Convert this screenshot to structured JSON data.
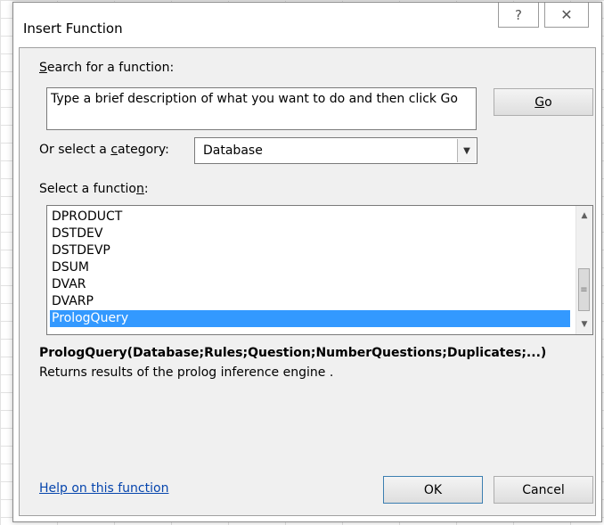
{
  "dialog": {
    "title": "Insert Function",
    "help_icon": "question-mark-icon",
    "close_icon": "close-icon",
    "help_glyph": "?",
    "close_glyph": "✕"
  },
  "search": {
    "label_pre": "",
    "label_ul": "S",
    "label_post": "earch for a function:",
    "value": "Type a brief description of what you want to do and then click Go",
    "go_pre": "",
    "go_ul": "G",
    "go_post": "o"
  },
  "category": {
    "label_pre": "Or select a ",
    "label_ul": "c",
    "label_post": "ategory:",
    "value": "Database",
    "arrow_glyph": "▼"
  },
  "functions": {
    "label_pre": "Select a functio",
    "label_ul": "n",
    "label_post": ":",
    "items": [
      "DPRODUCT",
      "DSTDEV",
      "DSTDEVP",
      "DSUM",
      "DVAR",
      "DVARP",
      "PrologQuery"
    ],
    "selected_index": 6,
    "scroll_up_glyph": "▲",
    "scroll_down_glyph": "▼",
    "thumb_glyph": "≡"
  },
  "selected_function": {
    "syntax": "PrologQuery(Database;Rules;Question;NumberQuestions;Duplicates;...)",
    "description": "Returns results of the prolog inference engine ."
  },
  "footer": {
    "help_link": "Help on this function",
    "ok_label": "OK",
    "cancel_label": "Cancel"
  },
  "colors": {
    "selection": "#3399ff",
    "link": "#0645ad",
    "dialog_bg": "#f0f0f0"
  }
}
